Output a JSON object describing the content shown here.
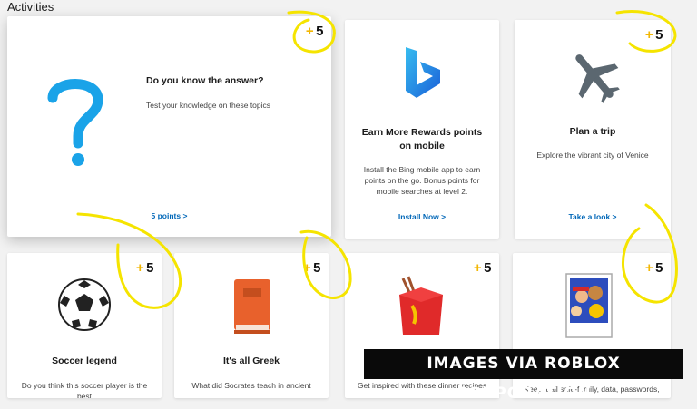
{
  "section": {
    "title": "Activities"
  },
  "cards": [
    {
      "points_plus": "+",
      "points_value": "5",
      "title": "Do you know the answer?",
      "desc": "Test your knowledge on these topics",
      "link": "5 points >",
      "icon": "question-mark-icon"
    },
    {
      "points_plus": "",
      "points_value": "",
      "title": "Earn More Rewards points on mobile",
      "desc": "Install the Bing mobile app to earn points on the go. Bonus points for mobile searches at level 2.",
      "link": "Install Now >",
      "icon": "bing-logo-icon"
    },
    {
      "points_plus": "+",
      "points_value": "5",
      "title": "Plan a trip",
      "desc": "Explore the vibrant city of Venice",
      "link": "Take a look >",
      "icon": "airplane-icon"
    },
    {
      "points_plus": "+",
      "points_value": "5",
      "title": "Soccer legend",
      "desc": "Do you think this soccer player is the best",
      "link": "",
      "icon": "soccer-ball-icon"
    },
    {
      "points_plus": "+",
      "points_value": "5",
      "title": "It's all Greek",
      "desc": "What did Socrates teach in ancient",
      "link": "",
      "icon": "book-icon"
    },
    {
      "points_plus": "+",
      "points_value": "5",
      "title": "",
      "desc": "Get inspired with these dinner recipes",
      "link": "",
      "icon": "takeout-box-icon"
    },
    {
      "points_plus": "+",
      "points_value": "5",
      "title": "",
      "desc": "Keep it all safe-family, data, passwords,",
      "link": "",
      "icon": "family-photo-icon"
    }
  ],
  "watermark": "IMAGES VIA ROBLOX CORPORATION",
  "colors": {
    "accent_yellow": "#f2b705",
    "link_blue": "#0067b8",
    "scribble": "#f5e400"
  }
}
